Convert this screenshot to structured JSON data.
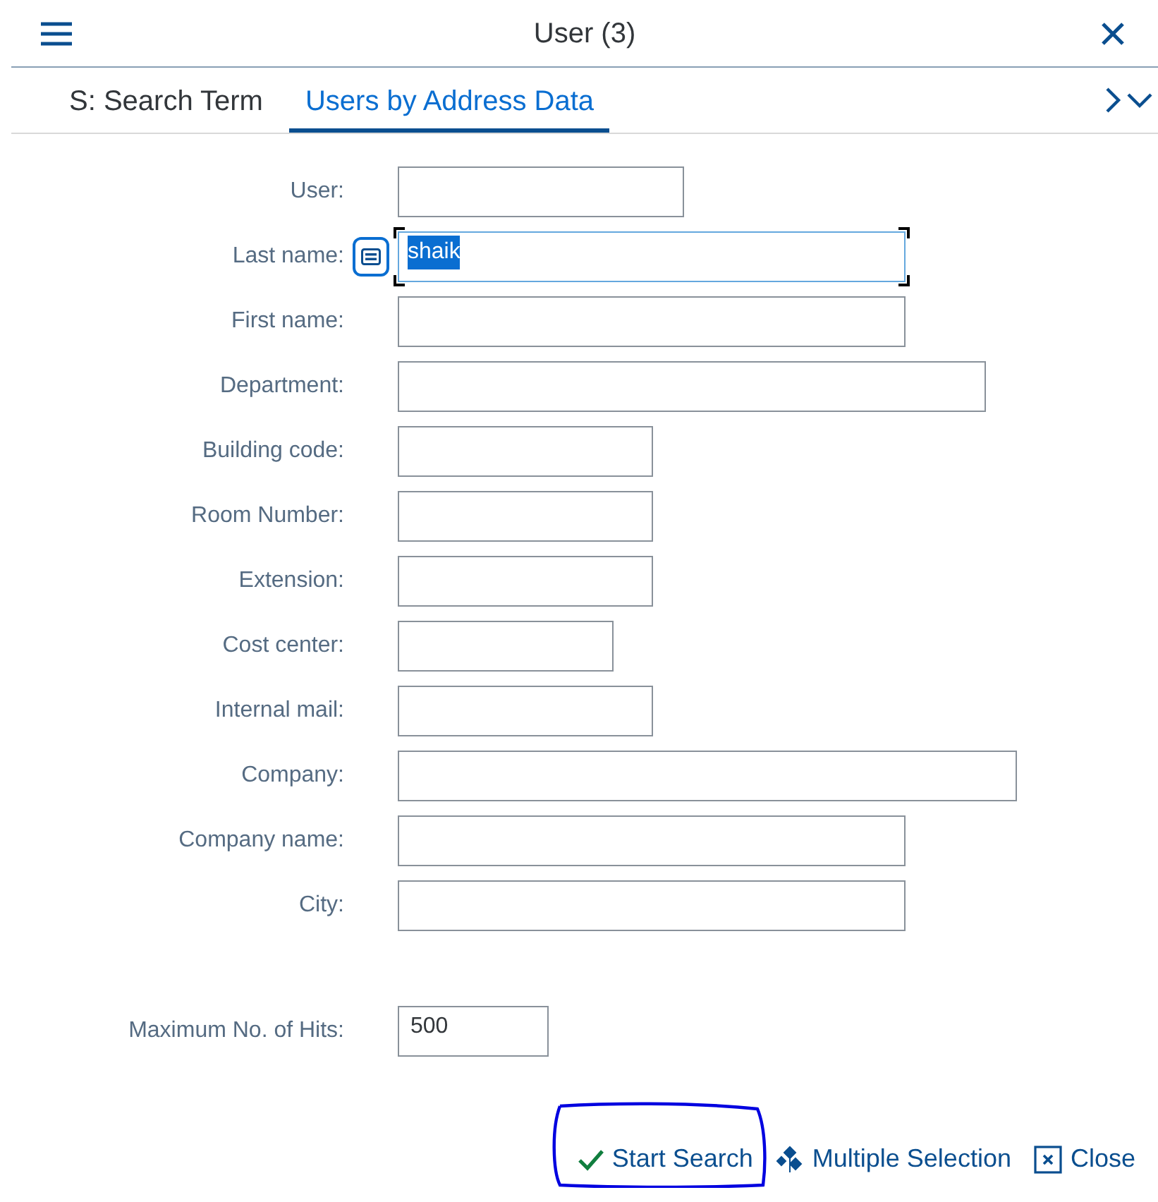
{
  "window": {
    "title": "User (3)"
  },
  "tabs": [
    {
      "label": "S: Search Term",
      "selected": false
    },
    {
      "label": "Users by Address Data",
      "selected": true
    }
  ],
  "fields": [
    {
      "label": "User:",
      "focused": false,
      "value_help": false
    },
    {
      "label": "Last name:",
      "value": "shaik",
      "focused": true,
      "value_help": true
    },
    {
      "label": "First name:",
      "focused": false,
      "value_help": false
    },
    {
      "label": "Department:",
      "focused": false,
      "value_help": false
    },
    {
      "label": "Building code:",
      "focused": false,
      "value_help": false
    },
    {
      "label": "Room Number:",
      "focused": false,
      "value_help": false
    },
    {
      "label": "Extension:",
      "focused": false,
      "value_help": false
    },
    {
      "label": "Cost center:",
      "focused": false,
      "value_help": false
    },
    {
      "label": "Internal mail:",
      "focused": false,
      "value_help": false
    },
    {
      "label": "Company:",
      "focused": false,
      "value_help": false
    },
    {
      "label": "Company name:",
      "focused": false,
      "value_help": false
    },
    {
      "label": "City:",
      "focused": false,
      "value_help": false
    }
  ],
  "max_hits": {
    "label": "Maximum No. of Hits:",
    "value": "500"
  },
  "buttons": [
    {
      "kind": "start",
      "label": "Start Search",
      "circled": true
    },
    {
      "kind": "multiple",
      "label": "Multiple Selection",
      "circled": false
    },
    {
      "kind": "close",
      "label": "Close",
      "circled": false
    }
  ]
}
